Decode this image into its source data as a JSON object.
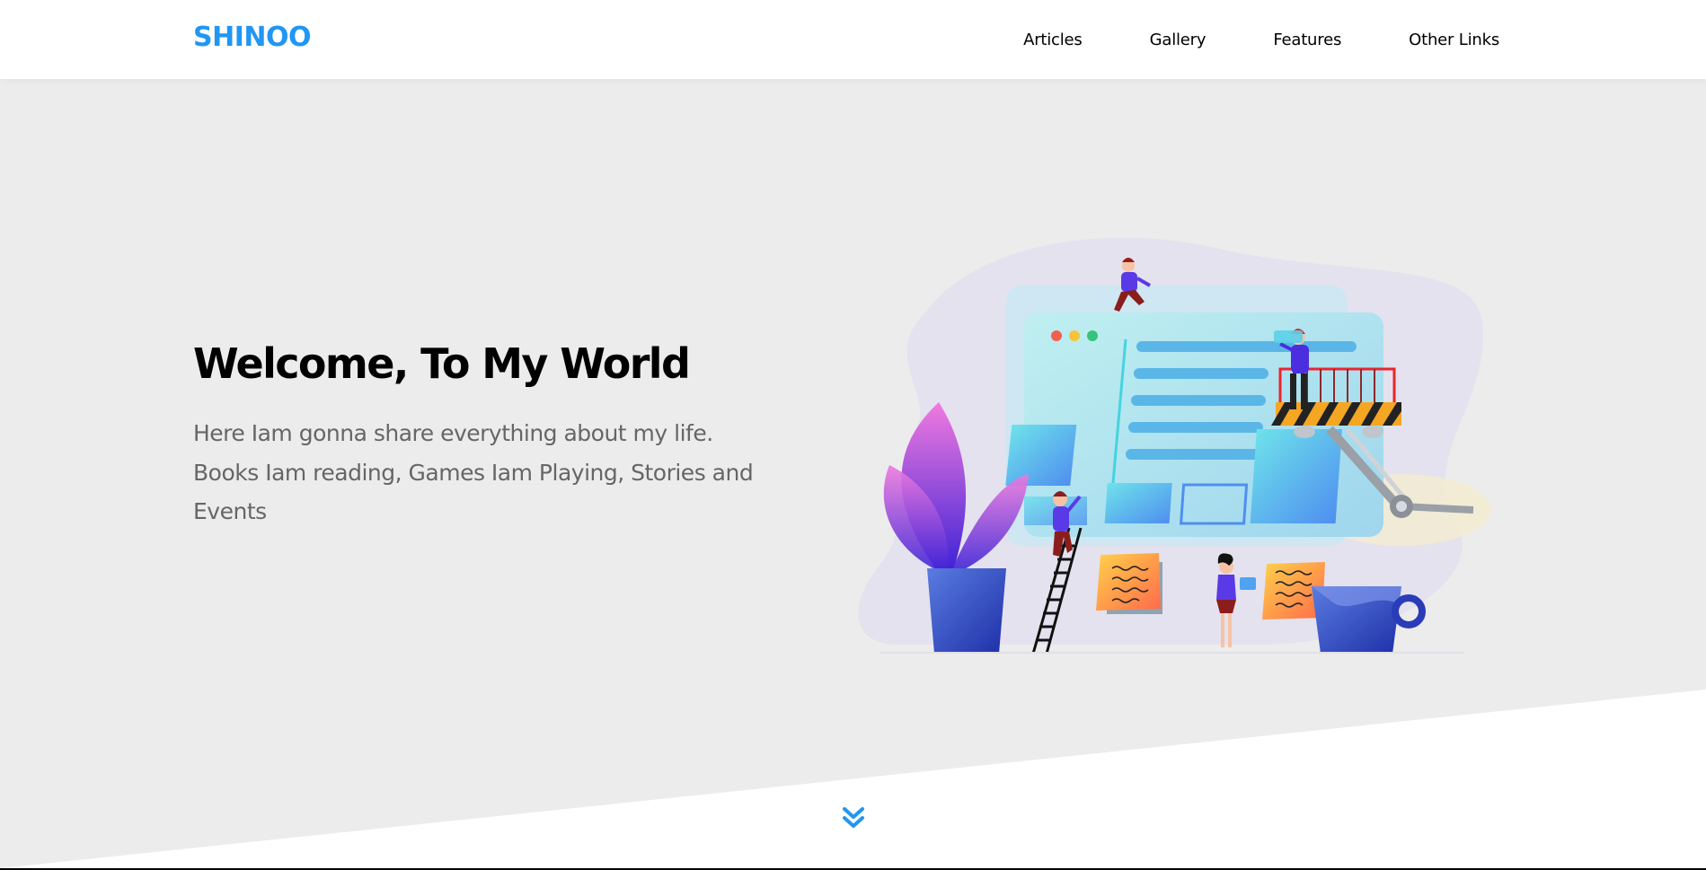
{
  "header": {
    "logo": "SHINOO",
    "nav": [
      {
        "label": "Articles"
      },
      {
        "label": "Gallery"
      },
      {
        "label": "Features"
      },
      {
        "label": "Other Links"
      }
    ]
  },
  "hero": {
    "title": "Welcome, To My World",
    "description": "Here Iam gonna share everything about my life. Books Iam reading, Games Iam Playing, Stories and Events"
  },
  "colors": {
    "brand": "#2196f3",
    "landing_bg": "#ececec",
    "header_bg": "#ffffff",
    "text_muted": "#666666"
  },
  "icons": {
    "scroll": "angle-double-down-icon"
  }
}
